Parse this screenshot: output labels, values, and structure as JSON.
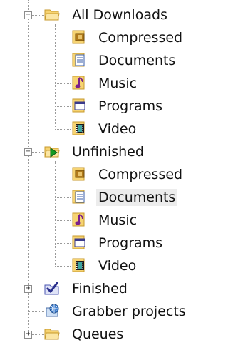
{
  "tree": {
    "all_downloads": {
      "label": "All Downloads",
      "expanded": true,
      "icon": "folder-open-icon",
      "children": [
        {
          "label": "Compressed",
          "icon": "compressed-archive-icon"
        },
        {
          "label": "Documents",
          "icon": "document-icon"
        },
        {
          "label": "Music",
          "icon": "music-note-icon"
        },
        {
          "label": "Programs",
          "icon": "program-window-icon"
        },
        {
          "label": "Video",
          "icon": "video-film-icon"
        }
      ]
    },
    "unfinished": {
      "label": "Unfinished",
      "expanded": true,
      "icon": "folder-play-icon",
      "children": [
        {
          "label": "Compressed",
          "icon": "compressed-archive-icon"
        },
        {
          "label": "Documents",
          "icon": "document-icon",
          "selected": true
        },
        {
          "label": "Music",
          "icon": "music-note-icon"
        },
        {
          "label": "Programs",
          "icon": "program-window-icon"
        },
        {
          "label": "Video",
          "icon": "video-film-icon"
        }
      ]
    },
    "finished": {
      "label": "Finished",
      "expanded": false,
      "icon": "folder-check-icon"
    },
    "grabber": {
      "label": "Grabber projects",
      "icon": "grabber-globe-icon"
    },
    "queues": {
      "label": "Queues",
      "expanded": false,
      "icon": "queues-folder-icon"
    }
  },
  "colors": {
    "folder_yellow": "#f6d372",
    "folder_edge": "#c79a2c",
    "selection_bg": "#ececec",
    "tree_line": "#9a9a9a"
  }
}
